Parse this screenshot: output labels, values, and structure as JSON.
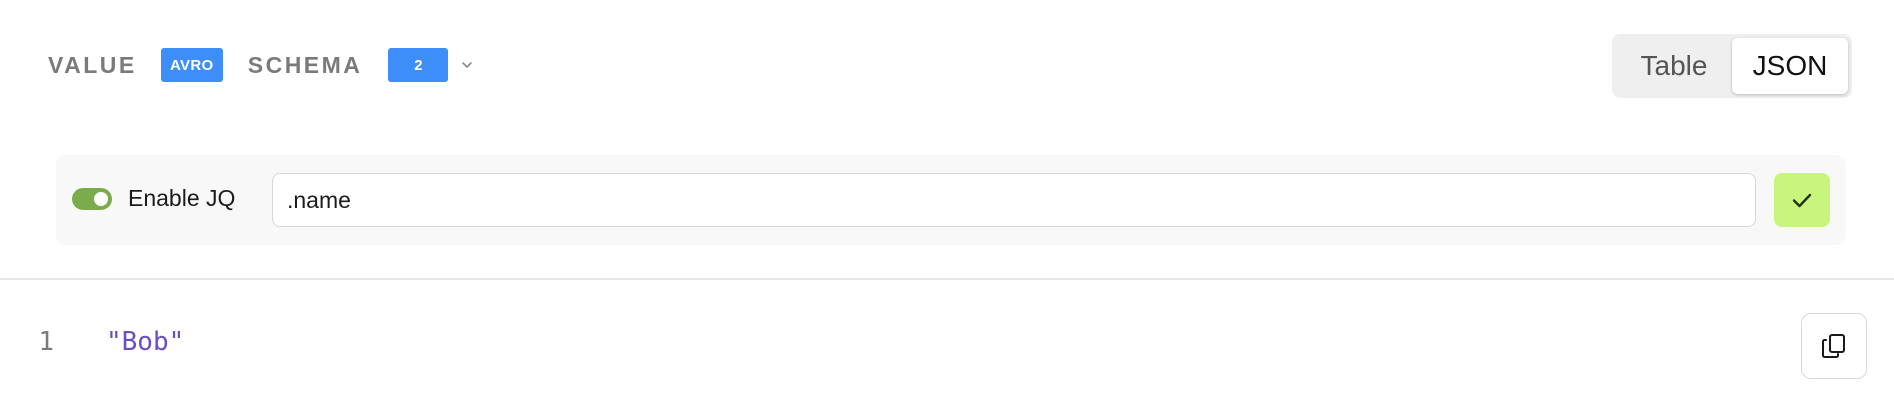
{
  "header": {
    "value_label": "VALUE",
    "value_format_badge": "AVRO",
    "schema_label": "SCHEMA",
    "schema_version_badge": "2",
    "schema_dropdown_icon": "chevron-down-icon",
    "badge_color": "#3d8ef8"
  },
  "view_toggle": {
    "options": [
      {
        "label": "Table",
        "active": false
      },
      {
        "label": "JSON",
        "active": true
      }
    ]
  },
  "jq": {
    "enabled": true,
    "toggle_label": "Enable JQ",
    "query_value": ".name",
    "apply_icon": "check-icon",
    "switch_color": "#7cab4c",
    "apply_color": "#c8f57c"
  },
  "output": {
    "lines": [
      {
        "number": "1",
        "content": "\"Bob\""
      }
    ],
    "string_color": "#6a4ec5",
    "copy_icon": "copy-icon"
  }
}
